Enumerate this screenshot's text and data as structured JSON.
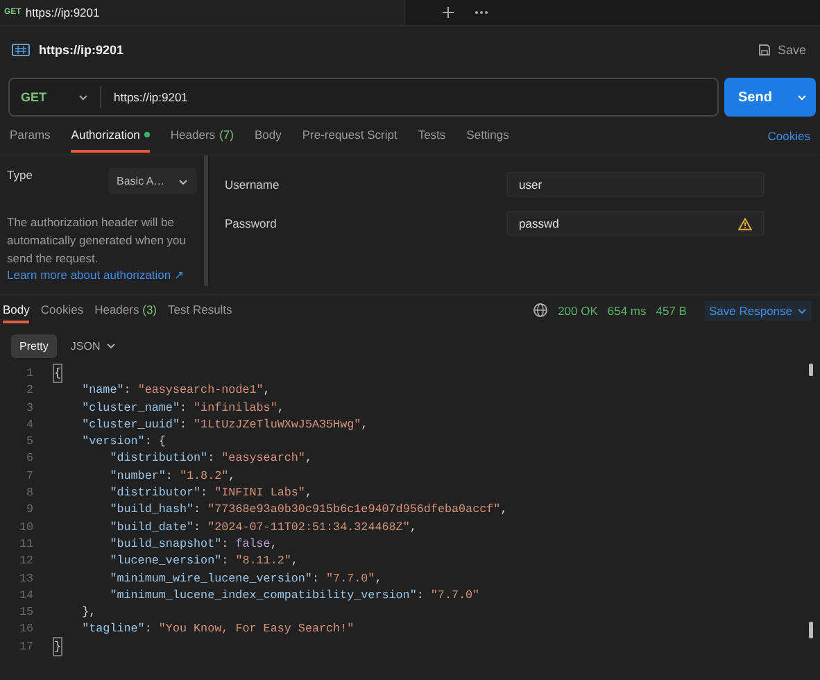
{
  "open_tab": {
    "method": "GET",
    "title": "https://ip:9201"
  },
  "request": {
    "name": "https://ip:9201",
    "save": "Save",
    "method": "GET",
    "url": "https://ip:9201",
    "send": "Send"
  },
  "request_tabs": [
    {
      "label": "Params",
      "selected": false,
      "modified": false
    },
    {
      "label": "Authorization",
      "selected": true,
      "modified": true
    },
    {
      "label": "Headers",
      "count": "(7)",
      "selected": false,
      "modified": false
    },
    {
      "label": "Body",
      "selected": false,
      "modified": false
    },
    {
      "label": "Pre-request Script",
      "selected": false,
      "modified": false
    },
    {
      "label": "Tests",
      "selected": false,
      "modified": false
    },
    {
      "label": "Settings",
      "selected": false,
      "modified": false
    }
  ],
  "cookies_link": "Cookies",
  "auth": {
    "type_label": "Type",
    "type_value": "Basic A…",
    "description": "The authorization header will be automatically generated when you send the request.",
    "link": "Learn more about authorization ↗",
    "fields": [
      {
        "label": "Username",
        "value": "user",
        "warning": false
      },
      {
        "label": "Password",
        "value": "passwd",
        "warning": true
      }
    ]
  },
  "response": {
    "tabs": [
      {
        "label": "Body",
        "selected": true
      },
      {
        "label": "Cookies",
        "selected": false
      },
      {
        "label": "Headers",
        "count": "(3)",
        "selected": false
      },
      {
        "label": "Test Results",
        "selected": false
      }
    ],
    "status": "200 OK",
    "time": "654 ms",
    "size": "457 B",
    "save": "Save Response",
    "views": [
      {
        "label": "Pretty",
        "selected": true
      }
    ],
    "format": "JSON",
    "lines": [
      {
        "number": "1",
        "tokens": [
          {
            "kind": "bracket",
            "text": "{"
          }
        ]
      },
      {
        "number": "2",
        "tokens": [
          {
            "kind": "key",
            "text": "    \"name\""
          },
          {
            "kind": "punct",
            "text": ": "
          },
          {
            "kind": "string",
            "text": "\"easysearch-node1\""
          },
          {
            "kind": "punct",
            "text": ","
          }
        ]
      },
      {
        "number": "3",
        "tokens": [
          {
            "kind": "key",
            "text": "    \"cluster_name\""
          },
          {
            "kind": "punct",
            "text": ": "
          },
          {
            "kind": "string",
            "text": "\"infinilabs\""
          },
          {
            "kind": "punct",
            "text": ","
          }
        ]
      },
      {
        "number": "4",
        "tokens": [
          {
            "kind": "key",
            "text": "    \"cluster_uuid\""
          },
          {
            "kind": "punct",
            "text": ": "
          },
          {
            "kind": "string",
            "text": "\"1LtUzJZeTluWXwJ5A35Hwg\""
          },
          {
            "kind": "punct",
            "text": ","
          }
        ]
      },
      {
        "number": "5",
        "tokens": [
          {
            "kind": "key",
            "text": "    \"version\""
          },
          {
            "kind": "punct",
            "text": ": {"
          }
        ]
      },
      {
        "number": "6",
        "tokens": [
          {
            "kind": "key",
            "text": "        \"distribution\""
          },
          {
            "kind": "punct",
            "text": ": "
          },
          {
            "kind": "string",
            "text": "\"easysearch\""
          },
          {
            "kind": "punct",
            "text": ","
          }
        ]
      },
      {
        "number": "7",
        "tokens": [
          {
            "kind": "key",
            "text": "        \"number\""
          },
          {
            "kind": "punct",
            "text": ": "
          },
          {
            "kind": "string",
            "text": "\"1.8.2\""
          },
          {
            "kind": "punct",
            "text": ","
          }
        ]
      },
      {
        "number": "8",
        "tokens": [
          {
            "kind": "key",
            "text": "        \"distributor\""
          },
          {
            "kind": "punct",
            "text": ": "
          },
          {
            "kind": "string",
            "text": "\"INFINI Labs\""
          },
          {
            "kind": "punct",
            "text": ","
          }
        ]
      },
      {
        "number": "9",
        "tokens": [
          {
            "kind": "key",
            "text": "        \"build_hash\""
          },
          {
            "kind": "punct",
            "text": ": "
          },
          {
            "kind": "string",
            "text": "\"77368e93a0b30c915b6c1e9407d956dfeba0accf\""
          },
          {
            "kind": "punct",
            "text": ","
          }
        ]
      },
      {
        "number": "10",
        "tokens": [
          {
            "kind": "key",
            "text": "        \"build_date\""
          },
          {
            "kind": "punct",
            "text": ": "
          },
          {
            "kind": "string",
            "text": "\"2024-07-11T02:51:34.324468Z\""
          },
          {
            "kind": "punct",
            "text": ","
          }
        ]
      },
      {
        "number": "11",
        "tokens": [
          {
            "kind": "key",
            "text": "        \"build_snapshot\""
          },
          {
            "kind": "punct",
            "text": ": "
          },
          {
            "kind": "boolean",
            "text": "false"
          },
          {
            "kind": "punct",
            "text": ","
          }
        ]
      },
      {
        "number": "12",
        "tokens": [
          {
            "kind": "key",
            "text": "        \"lucene_version\""
          },
          {
            "kind": "punct",
            "text": ": "
          },
          {
            "kind": "string",
            "text": "\"8.11.2\""
          },
          {
            "kind": "punct",
            "text": ","
          }
        ]
      },
      {
        "number": "13",
        "tokens": [
          {
            "kind": "key",
            "text": "        \"minimum_wire_lucene_version\""
          },
          {
            "kind": "punct",
            "text": ": "
          },
          {
            "kind": "string",
            "text": "\"7.7.0\""
          },
          {
            "kind": "punct",
            "text": ","
          }
        ]
      },
      {
        "number": "14",
        "tokens": [
          {
            "kind": "key",
            "text": "        \"minimum_lucene_index_compatibility_version\""
          },
          {
            "kind": "punct",
            "text": ": "
          },
          {
            "kind": "string",
            "text": "\"7.7.0\""
          }
        ]
      },
      {
        "number": "15",
        "tokens": [
          {
            "kind": "punct",
            "text": "    },"
          }
        ]
      },
      {
        "number": "16",
        "tokens": [
          {
            "kind": "key",
            "text": "    \"tagline\""
          },
          {
            "kind": "punct",
            "text": ": "
          },
          {
            "kind": "string",
            "text": "\"You Know, For Easy Search!\""
          }
        ]
      },
      {
        "number": "17",
        "tokens": [
          {
            "kind": "bracket",
            "text": "}"
          }
        ]
      }
    ]
  }
}
